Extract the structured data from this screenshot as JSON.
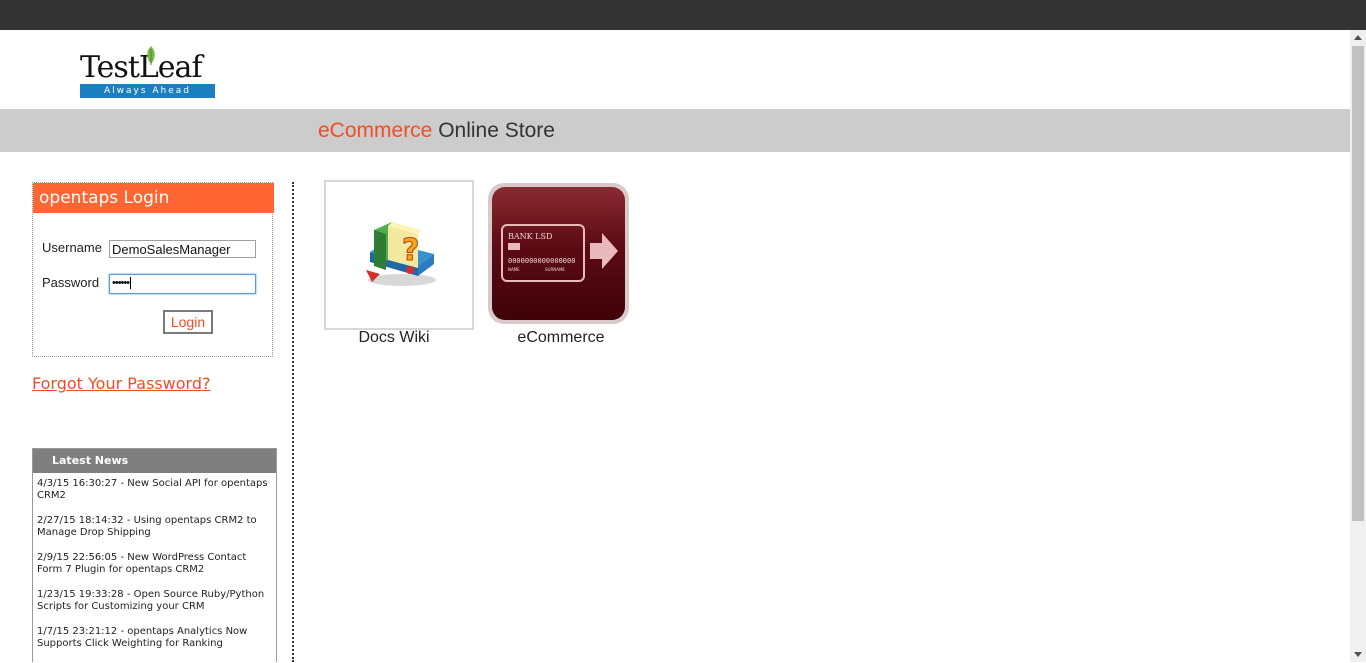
{
  "logo": {
    "wordmark": "TestLeaf",
    "tagline": "Always Ahead"
  },
  "banner": {
    "title_accent": "eCommerce",
    "title_rest": " Online Store"
  },
  "login": {
    "heading": "opentaps Login",
    "username_label": "Username",
    "username_value": "DemoSalesManager",
    "password_label": "Password",
    "password_value": "••••••",
    "button_label": "Login",
    "forgot_link": "Forgot Your Password?"
  },
  "news": {
    "heading": "Latest News",
    "items": [
      "4/3/15 16:30:27 - New Social API for opentaps CRM2",
      "2/27/15 18:14:32 - Using opentaps CRM2 to Manage Drop Shipping",
      "2/9/15 22:56:05 - New WordPress Contact Form 7 Plugin for opentaps CRM2",
      "1/23/15 19:33:28 - Open Source Ruby/Python Scripts for Customizing your CRM",
      "1/7/15 23:21:12 - opentaps Analytics Now Supports Click Weighting for Ranking"
    ]
  },
  "apps": [
    {
      "label": "Docs Wiki",
      "icon": "docs-wiki-icon"
    },
    {
      "label": "eCommerce",
      "icon": "credit-card-icon",
      "card_bank": "BANK LSD",
      "card_number": "0000000000000000",
      "card_name": "NAME",
      "card_surname": "SURNAME"
    }
  ],
  "colors": {
    "accent": "#f04e23",
    "login_header": "#ff6633",
    "banner": "#cccccc",
    "topbar": "#333333"
  }
}
